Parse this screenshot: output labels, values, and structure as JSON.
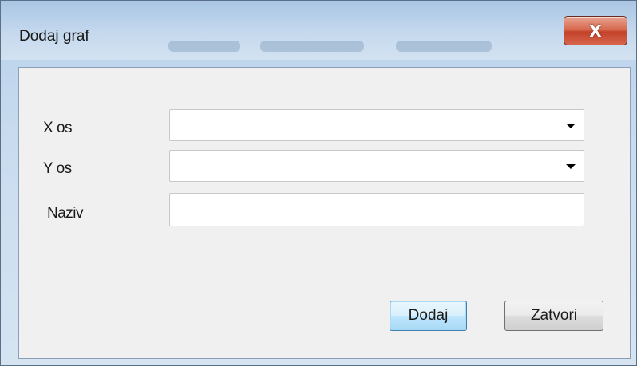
{
  "window": {
    "title": "Dodaj graf",
    "close_glyph": "X"
  },
  "form": {
    "x_axis": {
      "label": "X os",
      "value": ""
    },
    "y_axis": {
      "label": "Y os",
      "value": ""
    },
    "name": {
      "label": "Naziv",
      "value": ""
    }
  },
  "buttons": {
    "add_label": "Dodaj",
    "close_label": "Zatvori"
  },
  "icons": {
    "close": "close-icon",
    "dropdown": "chevron-down-icon"
  }
}
